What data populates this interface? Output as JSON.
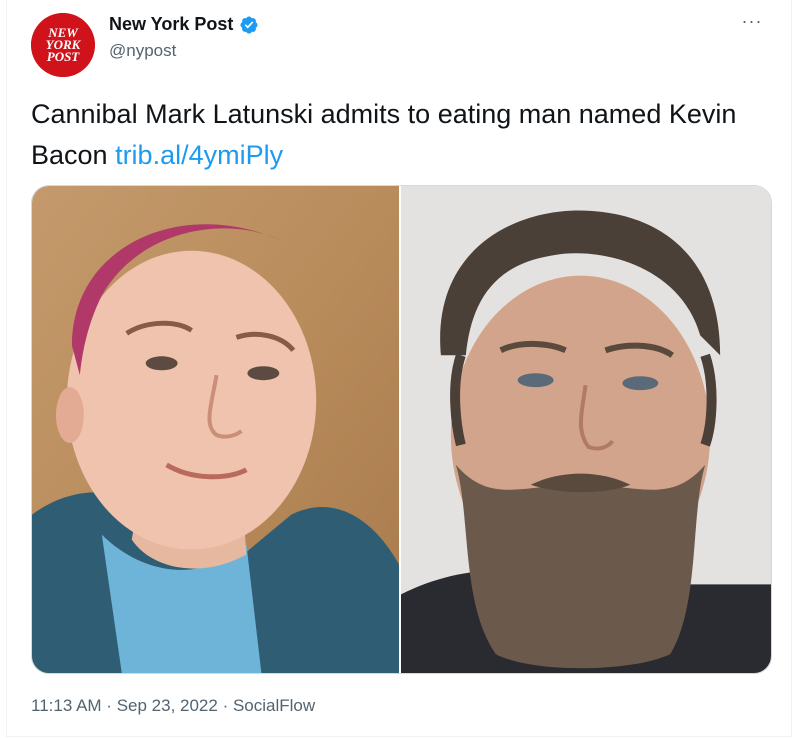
{
  "author": {
    "display_name": "New York Post",
    "handle": "@nypost",
    "avatar_text": "NEW YORK POST",
    "verified": true
  },
  "tweet": {
    "text": "Cannibal Mark Latunski admits to eating man named Kevin Bacon ",
    "link": "trib.al/4ymiPly",
    "time": "11:13 AM",
    "date": "Sep 23, 2022",
    "source": "SocialFlow",
    "sep": " · "
  },
  "colors": {
    "link": "#1d9bf0",
    "verified": "#1d9bf0",
    "avatar_bg": "#d0121a",
    "secondary_text": "#536471"
  },
  "icons": {
    "verified": "verified-badge-icon",
    "more": "more-options-icon"
  }
}
